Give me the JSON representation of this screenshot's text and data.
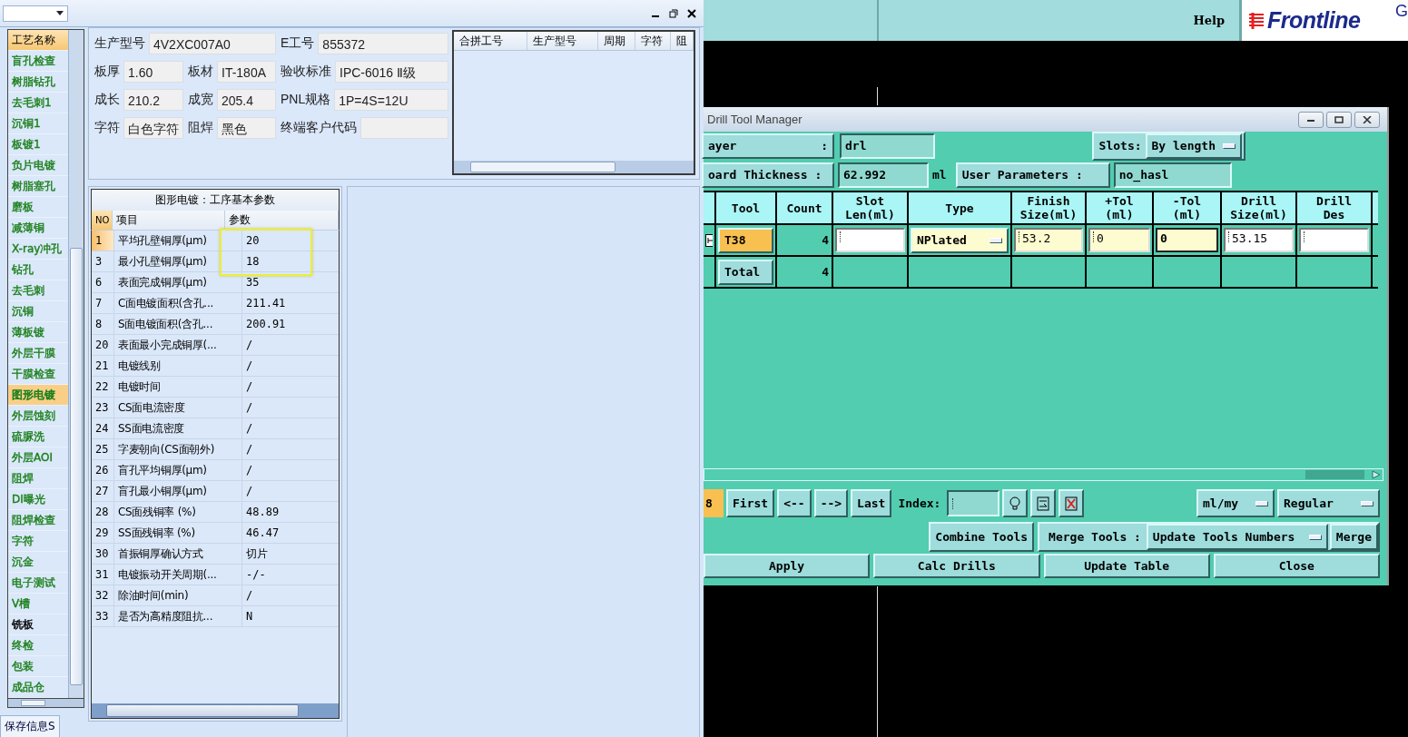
{
  "left_app": {
    "sidebar": {
      "header": "工艺名称",
      "items": [
        {
          "label": "盲孔检查",
          "selected": false,
          "color": "#1b7f1b"
        },
        {
          "label": "树脂钻孔",
          "selected": false,
          "color": "#1b7f1b"
        },
        {
          "label": "去毛刺1",
          "selected": false,
          "color": "#1b7f1b"
        },
        {
          "label": "沉铜1",
          "selected": false,
          "color": "#1b7f1b"
        },
        {
          "label": "板镀1",
          "selected": false,
          "color": "#1b7f1b"
        },
        {
          "label": "负片电镀",
          "selected": false,
          "color": "#1b7f1b"
        },
        {
          "label": "树脂塞孔",
          "selected": false,
          "color": "#1b7f1b"
        },
        {
          "label": "磨板",
          "selected": false,
          "color": "#1b7f1b"
        },
        {
          "label": "减薄铜",
          "selected": false,
          "color": "#1b7f1b"
        },
        {
          "label": "X-ray冲孔",
          "selected": false,
          "color": "#1b7f1b"
        },
        {
          "label": "钻孔",
          "selected": false,
          "color": "#1b7f1b"
        },
        {
          "label": "去毛刺",
          "selected": false,
          "color": "#1b7f1b"
        },
        {
          "label": "沉铜",
          "selected": false,
          "color": "#1b7f1b"
        },
        {
          "label": "薄板镀",
          "selected": false,
          "color": "#1b7f1b"
        },
        {
          "label": "外层干膜",
          "selected": false,
          "color": "#1b7f1b"
        },
        {
          "label": "干膜检查",
          "selected": false,
          "color": "#1b7f1b"
        },
        {
          "label": "图形电镀",
          "selected": true,
          "color": "#1b7f1b"
        },
        {
          "label": "外层蚀刻",
          "selected": false,
          "color": "#1b7f1b"
        },
        {
          "label": "硫脲洗",
          "selected": false,
          "color": "#1b7f1b"
        },
        {
          "label": "外层AOI",
          "selected": false,
          "color": "#1b7f1b"
        },
        {
          "label": "阻焊",
          "selected": false,
          "color": "#1b7f1b"
        },
        {
          "label": "DI曝光",
          "selected": false,
          "color": "#1b7f1b"
        },
        {
          "label": "阻焊检查",
          "selected": false,
          "color": "#1b7f1b"
        },
        {
          "label": "字符",
          "selected": false,
          "color": "#1b7f1b"
        },
        {
          "label": "沉金",
          "selected": false,
          "color": "#1b7f1b"
        },
        {
          "label": "电子测试",
          "selected": false,
          "color": "#1b7f1b"
        },
        {
          "label": "V槽",
          "selected": false,
          "color": "#1b7f1b"
        },
        {
          "label": "铣板",
          "selected": false,
          "color": "#000000"
        },
        {
          "label": "终检",
          "selected": false,
          "color": "#1b7f1b"
        },
        {
          "label": "包装",
          "selected": false,
          "color": "#1b7f1b"
        },
        {
          "label": "成品仓",
          "selected": false,
          "color": "#1b7f1b"
        }
      ]
    },
    "save_tab": "保存信息S",
    "job_info": {
      "fields": [
        {
          "label": "生产型号",
          "value": "4V2XC007A0"
        },
        {
          "label": "E工号",
          "value": "855372"
        },
        {
          "label": "板厚",
          "value": "1.60"
        },
        {
          "label": "板材",
          "value": "IT-180A"
        },
        {
          "label": "验收标准",
          "value": "IPC-6016 Ⅱ级"
        },
        {
          "label": "成长",
          "value": "210.2"
        },
        {
          "label": "成宽",
          "value": "205.4"
        },
        {
          "label": "PNL规格",
          "value": "1P=4S=12U"
        },
        {
          "label": "字符",
          "value": "白色字符"
        },
        {
          "label": "阻焊",
          "value": "黑色"
        },
        {
          "label": "终端客户代码"
        }
      ]
    },
    "merged_table": {
      "columns": [
        "合拼工号",
        "生产型号",
        "周期",
        "字符",
        "阻"
      ]
    },
    "params": {
      "title": "图形电镀：工序基本参数",
      "columns": [
        "NO",
        "项目",
        "参数"
      ],
      "rows": [
        {
          "no": "1",
          "item": "平均孔壁铜厚(μm)",
          "value": "20",
          "selected": true,
          "highlighted": true
        },
        {
          "no": "3",
          "item": "最小孔壁铜厚(μm)",
          "value": "18",
          "selected": false,
          "highlighted": true
        },
        {
          "no": "6",
          "item": "表面完成铜厚(μm)",
          "value": "35",
          "selected": false,
          "highlighted": false
        },
        {
          "no": "7",
          "item": "C面电镀面积(含孔...",
          "value": "211.41",
          "selected": false,
          "highlighted": false
        },
        {
          "no": "8",
          "item": "S面电镀面积(含孔...",
          "value": "200.91",
          "selected": false,
          "highlighted": false
        },
        {
          "no": "20",
          "item": "表面最小完成铜厚(...",
          "value": "/",
          "selected": false,
          "highlighted": false
        },
        {
          "no": "21",
          "item": "电镀线别",
          "value": "/",
          "selected": false,
          "highlighted": false
        },
        {
          "no": "22",
          "item": "电镀时间",
          "value": "/",
          "selected": false,
          "highlighted": false
        },
        {
          "no": "23",
          "item": "CS面电流密度",
          "value": "/",
          "selected": false,
          "highlighted": false
        },
        {
          "no": "24",
          "item": "SS面电流密度",
          "value": "/",
          "selected": false,
          "highlighted": false
        },
        {
          "no": "25",
          "item": "字麦朝向(CS面朝外)",
          "value": "/",
          "selected": false,
          "highlighted": false
        },
        {
          "no": "26",
          "item": "盲孔平均铜厚(μm)",
          "value": "/",
          "selected": false,
          "highlighted": false
        },
        {
          "no": "27",
          "item": "盲孔最小铜厚(μm)",
          "value": "/",
          "selected": false,
          "highlighted": false
        },
        {
          "no": "28",
          "item": "CS面残铜率 (%)",
          "value": "48.89",
          "selected": false,
          "highlighted": false
        },
        {
          "no": "29",
          "item": "SS面残铜率 (%)",
          "value": "46.47",
          "selected": false,
          "highlighted": false
        },
        {
          "no": "30",
          "item": "首振铜厚确认方式",
          "value": "切片",
          "selected": false,
          "highlighted": false
        },
        {
          "no": "31",
          "item": "电镀振动开关周期(...",
          "value": "-/-",
          "selected": false,
          "highlighted": false
        },
        {
          "no": "32",
          "item": "除油时间(min)",
          "value": "/",
          "selected": false,
          "highlighted": false
        },
        {
          "no": "33",
          "item": "是否为高精度阻抗...",
          "value": "N",
          "selected": false,
          "highlighted": false
        }
      ]
    }
  },
  "top_bar": {
    "help": "Help",
    "logo": "Frontline",
    "logo_cut": "G"
  },
  "drill_tool_manager": {
    "title": "Drill Tool Manager",
    "layer": {
      "label": "ayer",
      "colon": ":",
      "value": "drl"
    },
    "slots": {
      "label": "Slots:",
      "value": "By length"
    },
    "thickness": {
      "label": "oard Thickness :",
      "value": "62.992",
      "unit": "ml"
    },
    "user_parameters": {
      "label": "User Parameters :",
      "value": "no_hasl"
    },
    "columns": [
      "Tool",
      "Count",
      "Slot\nLen(ml)",
      "Type",
      "Finish\nSize(ml)",
      "+Tol\n(ml)",
      "-Tol\n(ml)",
      "Drill\nSize(ml)",
      "Drill\nDes"
    ],
    "rows": [
      {
        "kind": "tool",
        "tool": "T38",
        "selected": true,
        "count": "4",
        "type": "NPlated",
        "finish": "53.2",
        "plus_tol": "0",
        "minus_tol": "0",
        "drill_size": "53.15"
      },
      {
        "kind": "total",
        "tool": "Total",
        "selected": false,
        "count": "4"
      }
    ],
    "nav": {
      "current": "8",
      "buttons": [
        "First",
        "<--",
        "-->",
        "Last"
      ],
      "index_label": "Index:",
      "units": "ml/my",
      "mode": "Regular"
    },
    "merge": {
      "combine": "Combine Tools",
      "label": "Merge Tools :",
      "option": "Update Tools Numbers",
      "button": "Merge"
    },
    "actions": [
      "Apply",
      "Calc Drills",
      "Update Table",
      "Close"
    ]
  }
}
